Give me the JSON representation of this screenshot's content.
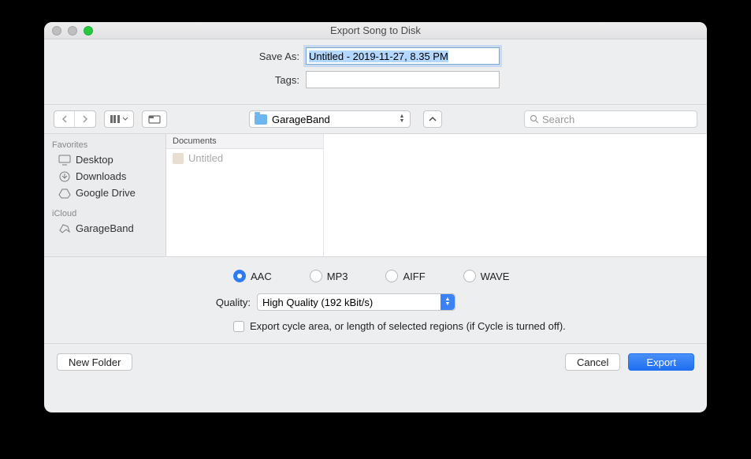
{
  "title": "Export Song to Disk",
  "form": {
    "save_as_label": "Save As:",
    "save_as_value": "Untitled - 2019-11-27, 8.35 PM",
    "tags_label": "Tags:",
    "tags_value": ""
  },
  "toolbar": {
    "path": "GarageBand",
    "search_placeholder": "Search"
  },
  "sidebar": {
    "fav_header": "Favorites",
    "favorites": [
      "Desktop",
      "Downloads",
      "Google Drive"
    ],
    "icloud_header": "iCloud",
    "icloud": [
      "GarageBand"
    ]
  },
  "columns": {
    "header": "Documents",
    "items": [
      "Untitled"
    ]
  },
  "formats": {
    "options": [
      "AAC",
      "MP3",
      "AIFF",
      "WAVE"
    ],
    "selected": "AAC"
  },
  "quality": {
    "label": "Quality:",
    "value": "High Quality (192 kBit/s)"
  },
  "cycle_text": "Export cycle area, or length of selected regions (if Cycle is turned off).",
  "footer": {
    "new_folder": "New Folder",
    "cancel": "Cancel",
    "export": "Export"
  }
}
